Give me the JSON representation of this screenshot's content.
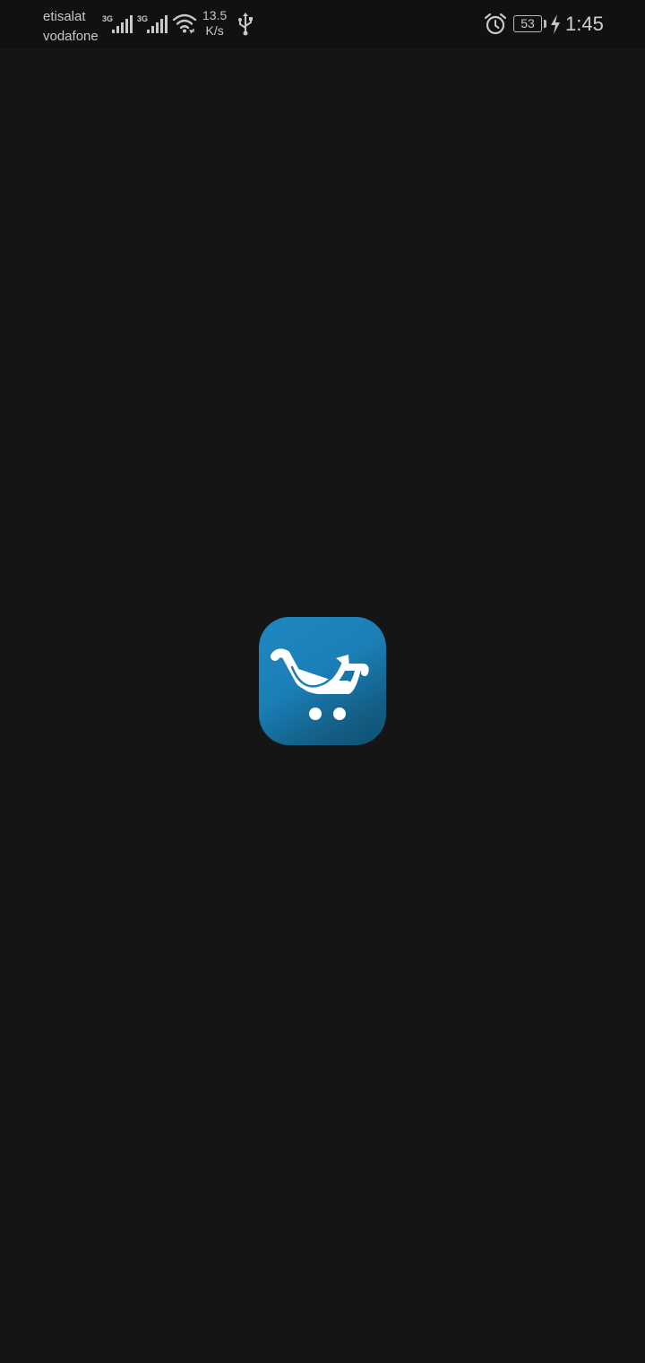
{
  "status_bar": {
    "carrier_1": "etisalat",
    "carrier_2": "vodafone",
    "network_1": "3G",
    "network_2": "3G",
    "speed_value": "13.5",
    "speed_unit": "K/s",
    "battery_level": "53",
    "time": "1:45",
    "icons": [
      "signal-icon",
      "wifi-icon",
      "usb-icon",
      "alarm-icon",
      "battery-icon",
      "charging-icon"
    ]
  },
  "splash": {
    "logo_icon": "shopping-cart-arrow-icon",
    "logo_gradient": [
      "#1f88c0",
      "#0f4f72"
    ],
    "background": "#151515"
  }
}
